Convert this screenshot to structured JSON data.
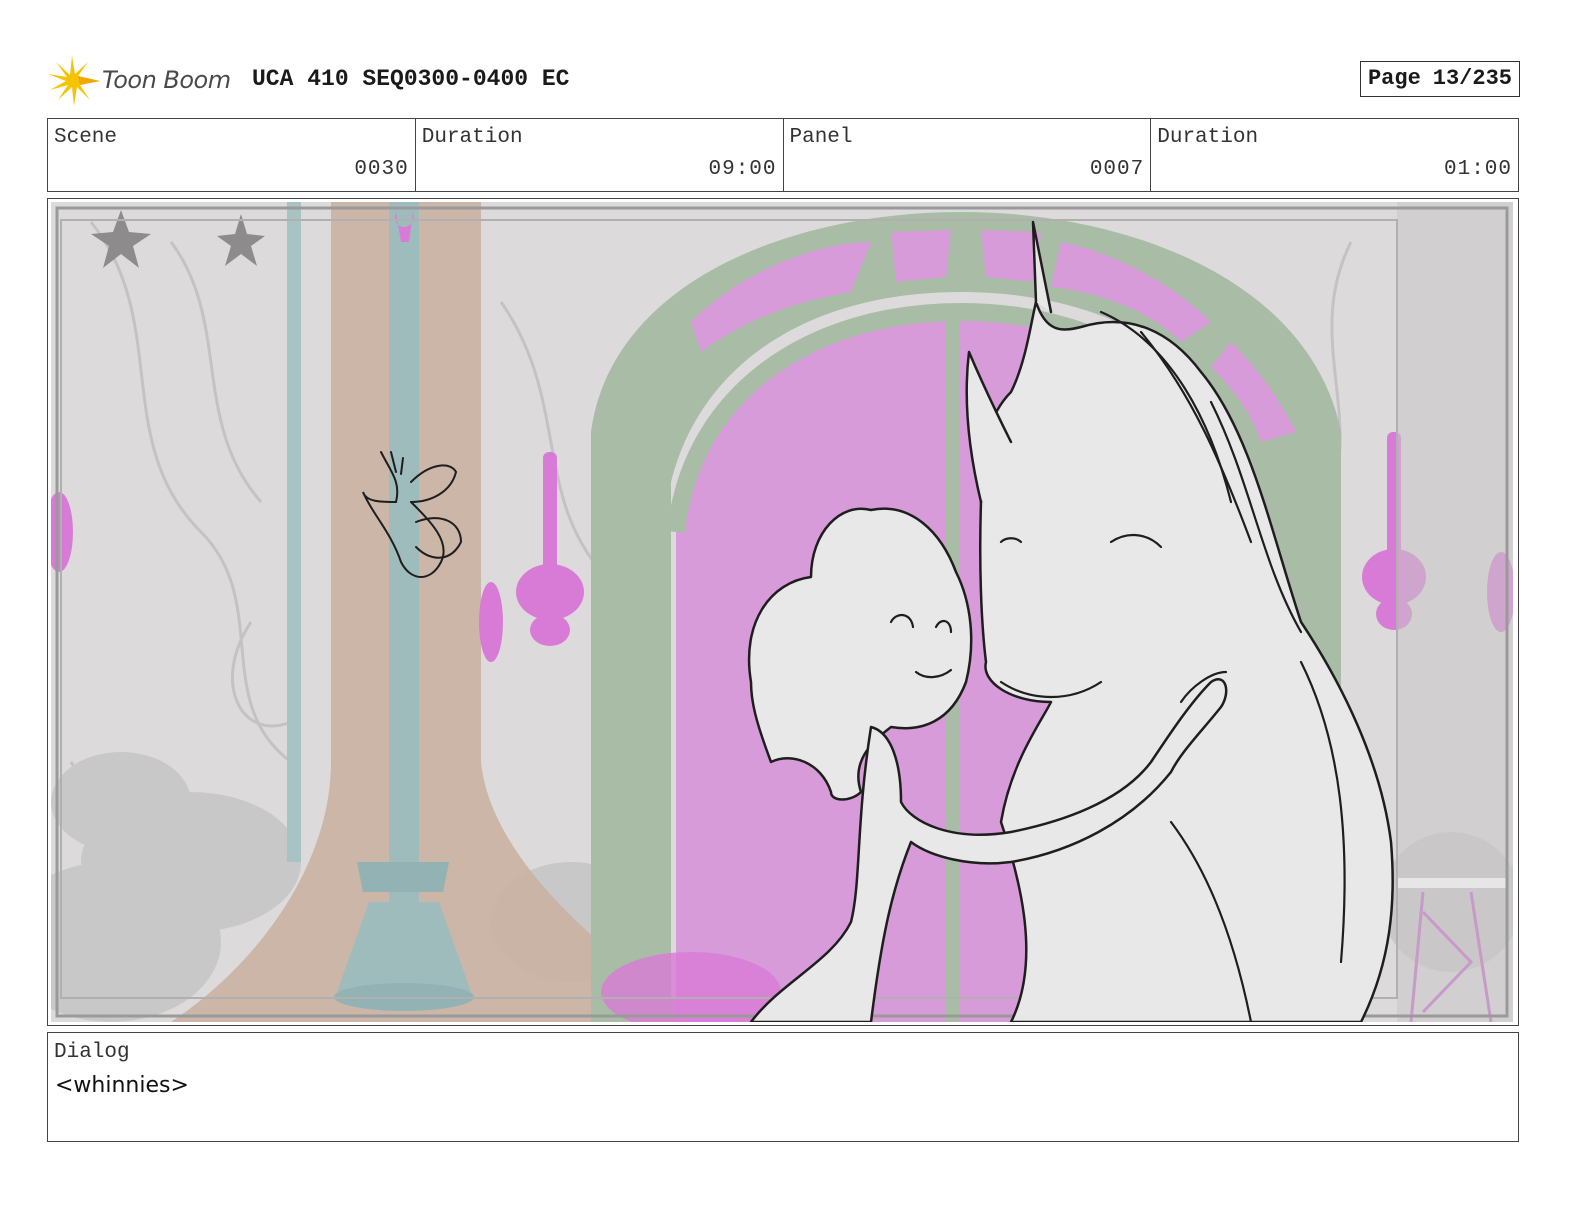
{
  "header": {
    "logo_text": "Toon Boom",
    "title": "UCA 410 SEQ0300-0400 EC",
    "page_label": "Page",
    "page_value": "13/235"
  },
  "info": {
    "scene_label": "Scene",
    "scene_value": "0030",
    "scene_duration_label": "Duration",
    "scene_duration_value": "09:00",
    "panel_label": "Panel",
    "panel_value": "0007",
    "panel_duration_label": "Duration",
    "panel_duration_value": "01:00"
  },
  "dialog": {
    "label": "Dialog",
    "text": "<whinnies>"
  },
  "colors": {
    "accent_logo": "#f5c400",
    "arch_green": "#a9bca6",
    "window_pink": "#d69bd8",
    "lamp_pink": "#d87bd6",
    "pillar_teal": "#9fbcbd",
    "pillar_tan": "#c9b1a2"
  }
}
